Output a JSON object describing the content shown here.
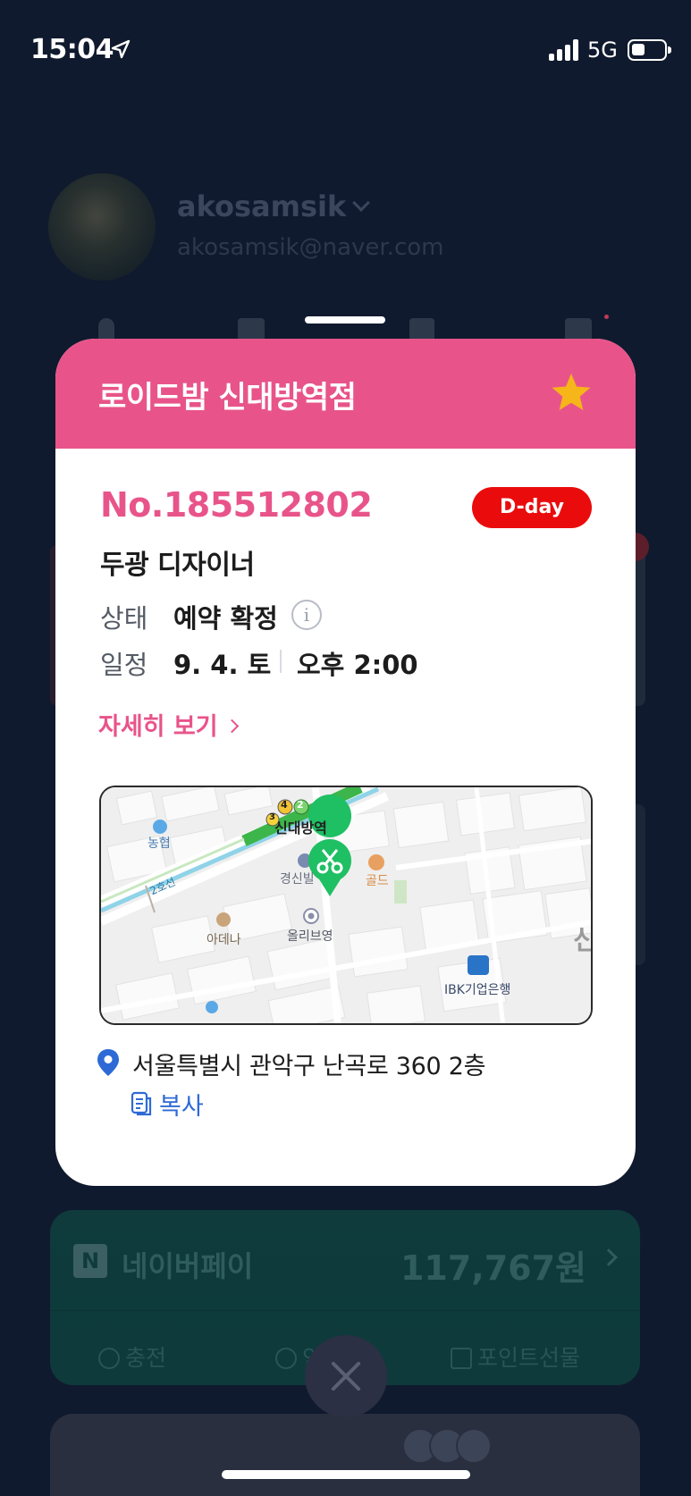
{
  "status_bar": {
    "time": "15:04",
    "network": "5G"
  },
  "profile": {
    "username": "akosamsik",
    "email": "akosamsik@naver.com"
  },
  "booking": {
    "shop_name": "로이드밤 신대방역점",
    "order_number": "No.185512802",
    "dday_badge": "D-day",
    "designer": "두광 디자이너",
    "status_label": "상태",
    "status_value": "예약 확정",
    "schedule_label": "일정",
    "schedule_date": "9. 4. 토",
    "schedule_time": "오후 2:00",
    "detail_link": "자세히 보기",
    "address": "서울특별시 관악구 난곡로 360 2층",
    "copy_label": "복사",
    "accent_color": "#e8548a"
  },
  "map": {
    "labels": {
      "station": "신대방역",
      "bank_nh": "농협",
      "line2": "2호선",
      "kyungsin": "경신빌",
      "gold": "골드",
      "adena": "아데나",
      "oliveyoung": "올리브영",
      "ibk": "IBK기업은행",
      "edge_char": "신",
      "line4_badge": "4",
      "line2_badge": "2",
      "line3_badge": "3"
    }
  },
  "naverpay": {
    "logo": "N",
    "title": "네이버페이",
    "amount": "117,767원",
    "actions": [
      "충전",
      "인",
      "포인트선물"
    ]
  },
  "icons": {
    "favorite": "star-icon",
    "info": "info-icon",
    "location": "location-pin-icon",
    "copy": "copy-icon",
    "close": "close-icon"
  }
}
